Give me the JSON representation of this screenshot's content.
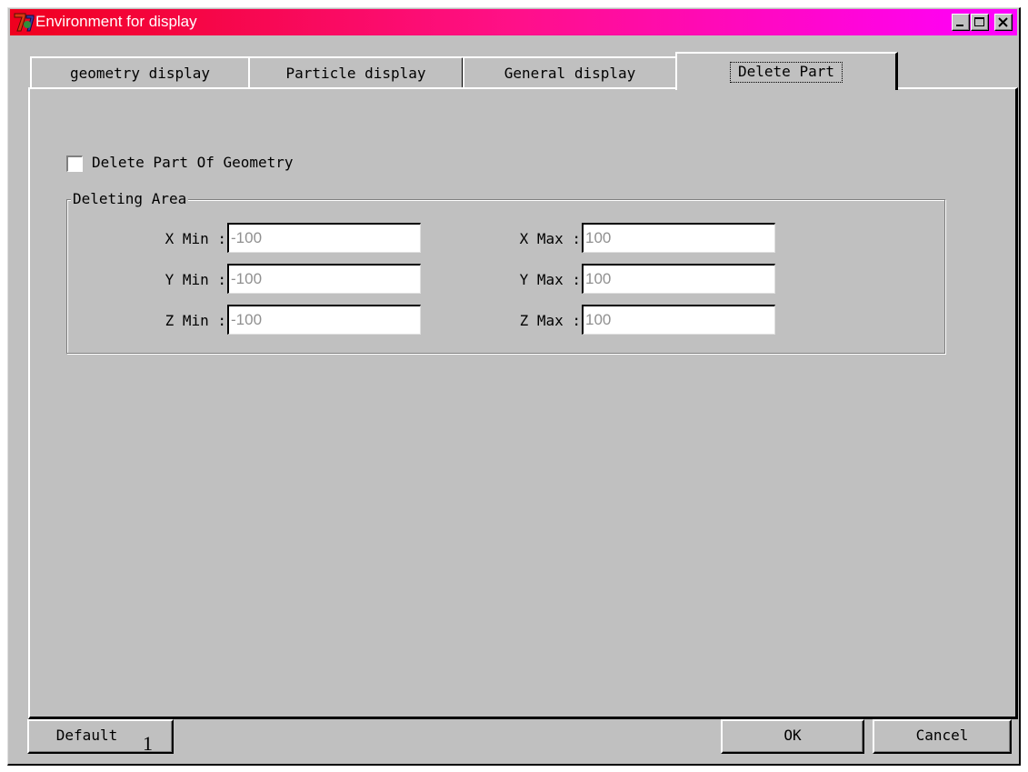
{
  "window": {
    "title": "Environment for display",
    "icon": "app-logo-icon",
    "controls": [
      "minimize-icon",
      "maximize-icon",
      "close-icon"
    ]
  },
  "tabs": [
    {
      "label": "geometry display",
      "active": false
    },
    {
      "label": "Particle display",
      "active": false
    },
    {
      "label": "General display",
      "active": false
    },
    {
      "label": "Delete Part",
      "active": true
    }
  ],
  "panel": {
    "checkbox_label": "Delete Part Of Geometry",
    "checkbox_checked": false,
    "group_label": "Deleting Area",
    "fields": {
      "x_min": {
        "label": "X Min :",
        "value": "-100"
      },
      "y_min": {
        "label": "Y Min :",
        "value": "-100"
      },
      "z_min": {
        "label": "Z Min :",
        "value": "-100"
      },
      "x_max": {
        "label": "X Max :",
        "value": "100"
      },
      "y_max": {
        "label": "Y Max :",
        "value": "100"
      },
      "z_max": {
        "label": "Z Max :",
        "value": "100"
      }
    }
  },
  "buttons": {
    "default": "Default",
    "ok": "OK",
    "cancel": "Cancel"
  },
  "overlay_marker": "1",
  "colors": {
    "title_gradient_start": "#f0001e",
    "title_gradient_end": "#ff00ff",
    "face": "#c0c0c0",
    "disabled_text": "#909090"
  }
}
